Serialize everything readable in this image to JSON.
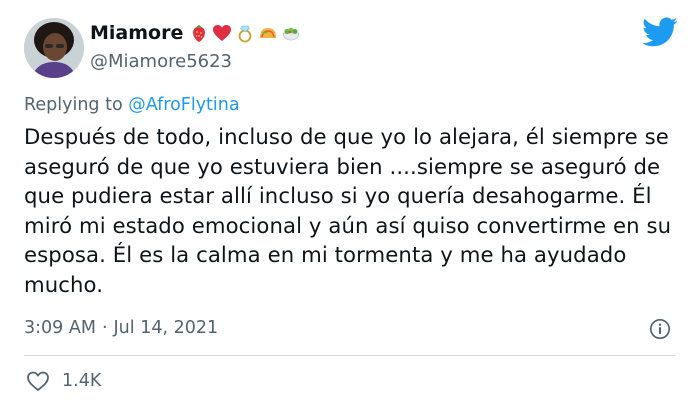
{
  "tweet": {
    "display_name": "Miamore",
    "name_emojis": [
      "strawberry-emoji",
      "red-heart-emoji",
      "ring-emoji",
      "taco-emoji",
      "salad-emoji"
    ],
    "handle": "@Miamore5623",
    "reply_prefix": "Replying to",
    "reply_to": "@AfroFlytina",
    "text": "Después de todo, incluso de que yo lo alejara, él siempre se aseguró de que yo estuviera bien ....siempre se aseguró de que pudiera estar allí incluso si yo quería desahogarme. Él miró mi estado emocional y aún así quiso convertirme en su esposa. Él es la calma en mi tormenta y me ha ayudado mucho.",
    "time": "3:09 AM",
    "separator": "·",
    "date": "Jul 14, 2021",
    "likes": "1.4K"
  },
  "colors": {
    "accent": "#1d9bf0",
    "text": "#0f1419",
    "secondary": "#536471",
    "divider": "#cfd9de"
  }
}
